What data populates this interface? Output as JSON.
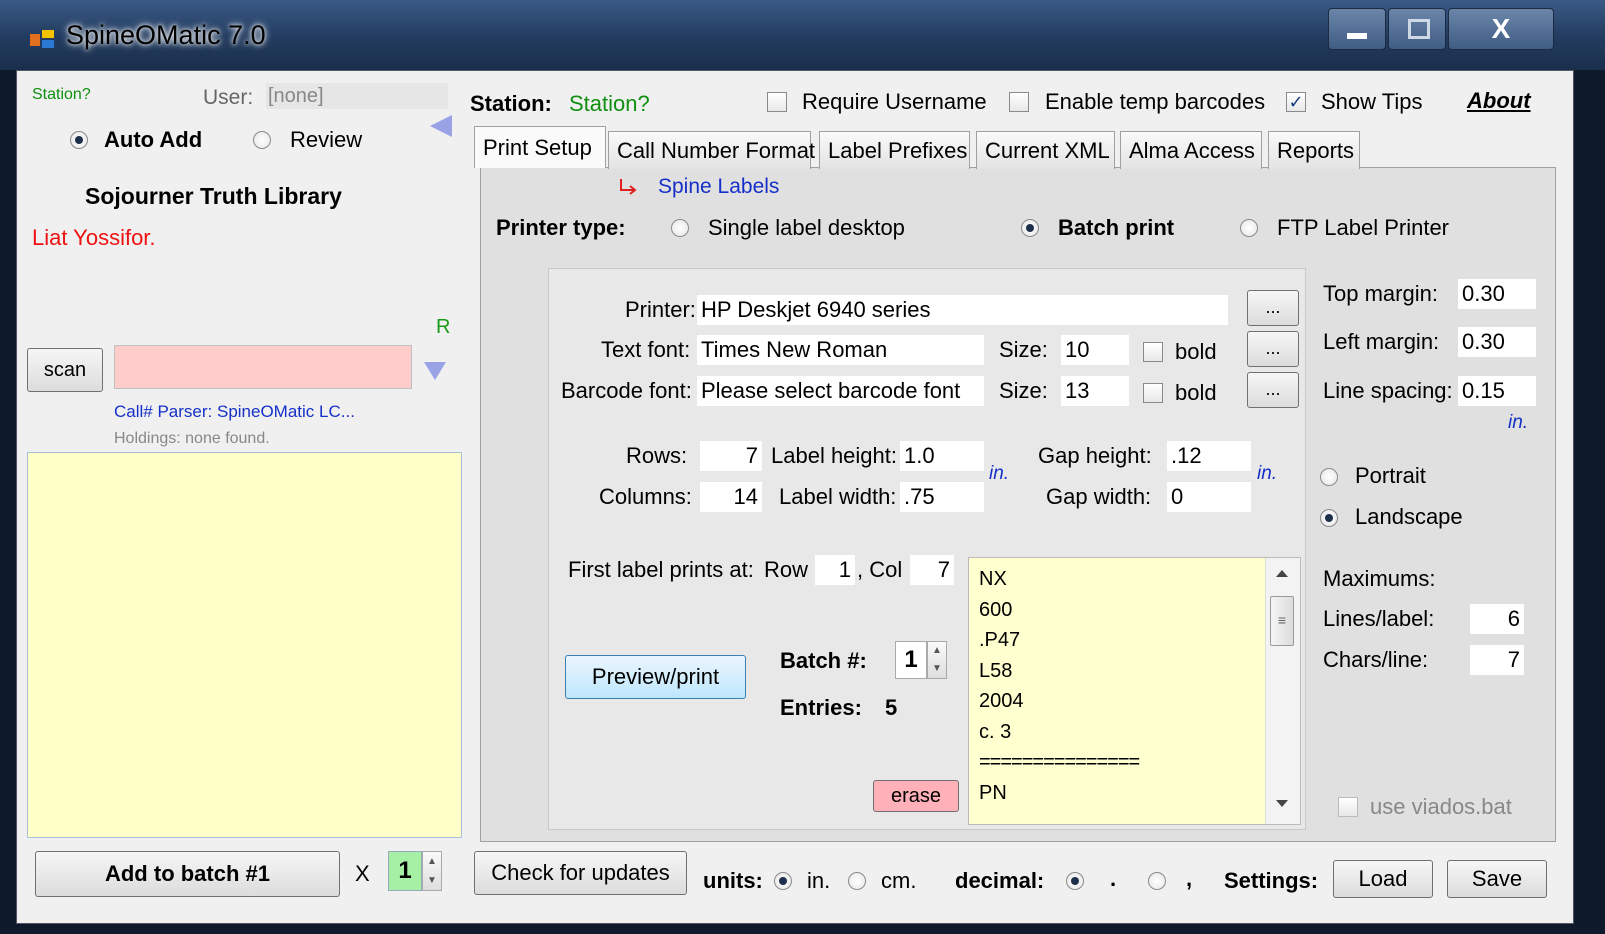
{
  "window": {
    "title": "SpineOMatic 7.0",
    "close_glyph": "X"
  },
  "left": {
    "station": "Station?",
    "user_label": "User:",
    "user_value": "[none]",
    "auto_add": "Auto Add",
    "review": "Review",
    "library": "Sojourner Truth Library",
    "patron": "Liat Yossifor.",
    "r_flag": "R",
    "scan_label": "scan",
    "scan_value": "",
    "parser": "Call# Parser: SpineOMatic LC...",
    "holdings": "Holdings: none found.",
    "add_batch": "Add to batch #1",
    "x_label": "X",
    "copies": "1"
  },
  "header": {
    "station_label": "Station:",
    "station_value": "Station?",
    "require_username": "Require Username",
    "enable_temp": "Enable temp barcodes",
    "show_tips": "Show Tips",
    "about": "About"
  },
  "tabs": [
    "Print Setup",
    "Call Number Format",
    "Label Prefixes",
    "Current XML",
    "Alma Access",
    "Reports"
  ],
  "print_setup": {
    "spine_labels": "Spine Labels",
    "printer_type_label": "Printer type:",
    "single_label": "Single label desktop",
    "batch_print": "Batch print",
    "ftp": "FTP Label Printer",
    "printer_label": "Printer:",
    "printer_value": "HP Deskjet 6940 series",
    "text_font_label": "Text font:",
    "text_font_value": "Times New Roman",
    "size_label": "Size:",
    "text_size": "10",
    "bold_label": "bold",
    "barcode_font_label": "Barcode font:",
    "barcode_font_value": "Please select barcode font",
    "barcode_size": "13",
    "browse": "...",
    "rows_label": "Rows:",
    "rows_value": "7",
    "columns_label": "Columns:",
    "columns_value": "14",
    "label_height_label": "Label height:",
    "label_height_value": "1.0",
    "label_width_label": "Label width:",
    "label_width_value": ".75",
    "unit_in": "in.",
    "gap_height_label": "Gap height:",
    "gap_height_value": ".12",
    "gap_width_label": "Gap width:",
    "gap_width_value": "0",
    "first_label_label": "First label prints at:",
    "row_word": "Row",
    "row_value": "1",
    "col_word": ", Col",
    "col_value": "7",
    "preview_print": "Preview/print",
    "batch_label": "Batch #:",
    "batch_value": "1",
    "entries_label": "Entries:",
    "entries_value": "5",
    "erase": "erase",
    "batch_lines": [
      "NX",
      "600",
      ".P47",
      "L58",
      "2004",
      "c. 3",
      "===============",
      "PN"
    ],
    "top_margin_label": "Top margin:",
    "top_margin_value": "0.30",
    "left_margin_label": "Left margin:",
    "left_margin_value": "0.30",
    "line_spacing_label": "Line spacing:",
    "line_spacing_value": "0.15",
    "portrait": "Portrait",
    "landscape": "Landscape",
    "maximums": "Maximums:",
    "lines_label": "Lines/label:",
    "lines_value": "6",
    "chars_label": "Chars/line:",
    "chars_value": "7",
    "use_viados": "use viados.bat"
  },
  "footer": {
    "check_updates": "Check for updates",
    "units_label": "units:",
    "unit_in": "in.",
    "unit_cm": "cm.",
    "decimal_label": "decimal:",
    "dec_dot": ".",
    "dec_comma": ",",
    "settings_label": "Settings:",
    "load": "Load",
    "save": "Save"
  }
}
